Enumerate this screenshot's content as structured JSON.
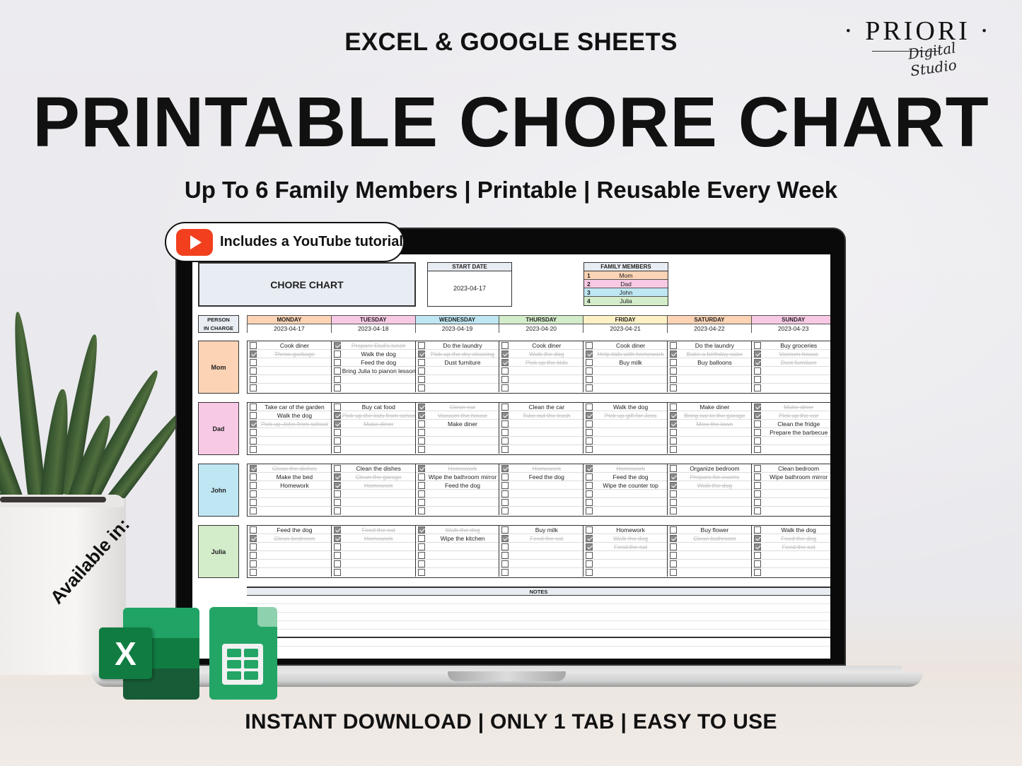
{
  "header": {
    "kicker": "EXCEL & GOOGLE SHEETS",
    "title": "PRINTABLE CHORE CHART",
    "subtitle": "Up To 6 Family Members | Printable | Reusable Every Week",
    "footer": "INSTANT DOWNLOAD  |  ONLY 1 TAB  |  EASY TO USE"
  },
  "brand": {
    "name": "· PRIORI ·",
    "tagline": "Digital Studio"
  },
  "youtube_badge": {
    "label": "Includes a YouTube tutorial",
    "icon": "youtube-play-icon",
    "color": "#f2401f"
  },
  "available": {
    "label": "Available in:",
    "apps": [
      {
        "name": "Microsoft Excel",
        "icon": "excel-icon",
        "glyph": "X"
      },
      {
        "name": "Google Sheets",
        "icon": "google-sheets-icon"
      }
    ]
  },
  "sheet": {
    "title": "CHORE CHART",
    "start_date_label": "START DATE",
    "start_date": "2023-04-17",
    "family_label": "FAMILY MEMBERS",
    "family": [
      {
        "num": "1",
        "name": "Mom",
        "color": "#fcd3b4"
      },
      {
        "num": "2",
        "name": "Dad",
        "color": "#f8c9e4"
      },
      {
        "num": "3",
        "name": "John",
        "color": "#bfe7f3"
      },
      {
        "num": "4",
        "name": "Julia",
        "color": "#d3ecc9"
      }
    ],
    "person_label_1": "PERSON",
    "person_label_2": "IN CHARGE",
    "days": [
      {
        "name": "MONDAY",
        "date": "2023-04-17",
        "color": "#fcd3b4"
      },
      {
        "name": "TUESDAY",
        "date": "2023-04-18",
        "color": "#f8c9e4"
      },
      {
        "name": "WEDNESDAY",
        "date": "2023-04-19",
        "color": "#bfe7f3"
      },
      {
        "name": "THURSDAY",
        "date": "2023-04-20",
        "color": "#d3ecc9"
      },
      {
        "name": "FRIDAY",
        "date": "2023-04-21",
        "color": "#fdf0c4"
      },
      {
        "name": "SATURDAY",
        "date": "2023-04-22",
        "color": "#fcd3b4"
      },
      {
        "name": "SUNDAY",
        "date": "2023-04-23",
        "color": "#f8c9e4"
      }
    ],
    "people": [
      {
        "name": "Mom",
        "tasks": [
          [
            {
              "t": "Cook diner",
              "d": false
            },
            {
              "t": "Throw garbage",
              "d": true
            }
          ],
          [
            {
              "t": "Prepare Dad's lunch",
              "d": true
            },
            {
              "t": "Walk the dog",
              "d": false
            },
            {
              "t": "Feed the dog",
              "d": false
            },
            {
              "t": "Bring Julia to pianon lesson",
              "d": false
            }
          ],
          [
            {
              "t": "Do the laundry",
              "d": false
            },
            {
              "t": "Pick up the dry cleaning",
              "d": true
            },
            {
              "t": "Dust furniture",
              "d": false
            }
          ],
          [
            {
              "t": "Cook diner",
              "d": false
            },
            {
              "t": "Walk the dog",
              "d": true
            },
            {
              "t": "Pick up the kids",
              "d": true
            }
          ],
          [
            {
              "t": "Cook diner",
              "d": false
            },
            {
              "t": "Help kids with homework",
              "d": true
            },
            {
              "t": "Buy milk",
              "d": false
            }
          ],
          [
            {
              "t": "Do the laundry",
              "d": false
            },
            {
              "t": "Bake a birthday cake",
              "d": true
            },
            {
              "t": "Buy balloons",
              "d": false
            }
          ],
          [
            {
              "t": "Buy groceries",
              "d": false
            },
            {
              "t": "Vaccum house",
              "d": true
            },
            {
              "t": "Dust furniture",
              "d": true
            }
          ]
        ]
      },
      {
        "name": "Dad",
        "tasks": [
          [
            {
              "t": "Take car of the garden",
              "d": false
            },
            {
              "t": "Walk the dog",
              "d": false
            },
            {
              "t": "Pick up John from school",
              "d": true
            }
          ],
          [
            {
              "t": "Buy cat food",
              "d": false
            },
            {
              "t": "Pick up the kids from school",
              "d": true
            },
            {
              "t": "Make diner",
              "d": true
            }
          ],
          [
            {
              "t": "Clean car",
              "d": true
            },
            {
              "t": "Vacuum the house",
              "d": true
            },
            {
              "t": "Make diner",
              "d": false
            }
          ],
          [
            {
              "t": "Clean the car",
              "d": false
            },
            {
              "t": "Take out the trash",
              "d": true
            }
          ],
          [
            {
              "t": "Walk the dog",
              "d": false
            },
            {
              "t": "Pick up gift for Jess",
              "d": true
            }
          ],
          [
            {
              "t": "Make diner",
              "d": false
            },
            {
              "t": "Bring car to the garage",
              "d": true
            },
            {
              "t": "Mow the lawn",
              "d": true
            }
          ],
          [
            {
              "t": "Make diner",
              "d": true
            },
            {
              "t": "Pick up the car",
              "d": true
            },
            {
              "t": "Clean the fridge",
              "d": false
            },
            {
              "t": "Prepare the barbecue",
              "d": false
            }
          ]
        ]
      },
      {
        "name": "John",
        "tasks": [
          [
            {
              "t": "Clean the dishes",
              "d": true
            },
            {
              "t": "Make the bed",
              "d": false
            },
            {
              "t": "Homework",
              "d": false
            }
          ],
          [
            {
              "t": "Clean the dishes",
              "d": false
            },
            {
              "t": "Clean the garage",
              "d": true
            },
            {
              "t": "Homework",
              "d": true
            }
          ],
          [
            {
              "t": "Homework",
              "d": true
            },
            {
              "t": "Wipe the bathroom mirror",
              "d": false
            },
            {
              "t": "Feed the dog",
              "d": false
            }
          ],
          [
            {
              "t": "Homework",
              "d": true
            },
            {
              "t": "Feed the dog",
              "d": false
            }
          ],
          [
            {
              "t": "Homework",
              "d": true
            },
            {
              "t": "Feed the dog",
              "d": false
            },
            {
              "t": "Wipe the counter top",
              "d": false
            }
          ],
          [
            {
              "t": "Organize bedroom",
              "d": false
            },
            {
              "t": "Prepare for exams",
              "d": true
            },
            {
              "t": "Walk the dog",
              "d": true
            }
          ],
          [
            {
              "t": "Clean bedroom",
              "d": false
            },
            {
              "t": "Wipe bathroom mirror",
              "d": false
            }
          ]
        ]
      },
      {
        "name": "Julia",
        "tasks": [
          [
            {
              "t": "Feed the dog",
              "d": false
            },
            {
              "t": "Clean bedroom",
              "d": true
            }
          ],
          [
            {
              "t": "Feed the cat",
              "d": true
            },
            {
              "t": "Homework",
              "d": true
            }
          ],
          [
            {
              "t": "Walk the dog",
              "d": true
            },
            {
              "t": "Wipe the kitchen",
              "d": false
            }
          ],
          [
            {
              "t": "Buy milk",
              "d": false
            },
            {
              "t": "Feed the cat",
              "d": true
            }
          ],
          [
            {
              "t": "Homework",
              "d": false
            },
            {
              "t": "Walk the dog",
              "d": true
            },
            {
              "t": "Feed the cat",
              "d": true
            }
          ],
          [
            {
              "t": "Buy flower",
              "d": false
            },
            {
              "t": "Clean bathroom",
              "d": true
            }
          ],
          [
            {
              "t": "Walk the dog",
              "d": false
            },
            {
              "t": "Feed the dog",
              "d": true
            },
            {
              "t": "Feed the cat",
              "d": true
            }
          ]
        ]
      }
    ],
    "notes_label": "NOTES"
  }
}
